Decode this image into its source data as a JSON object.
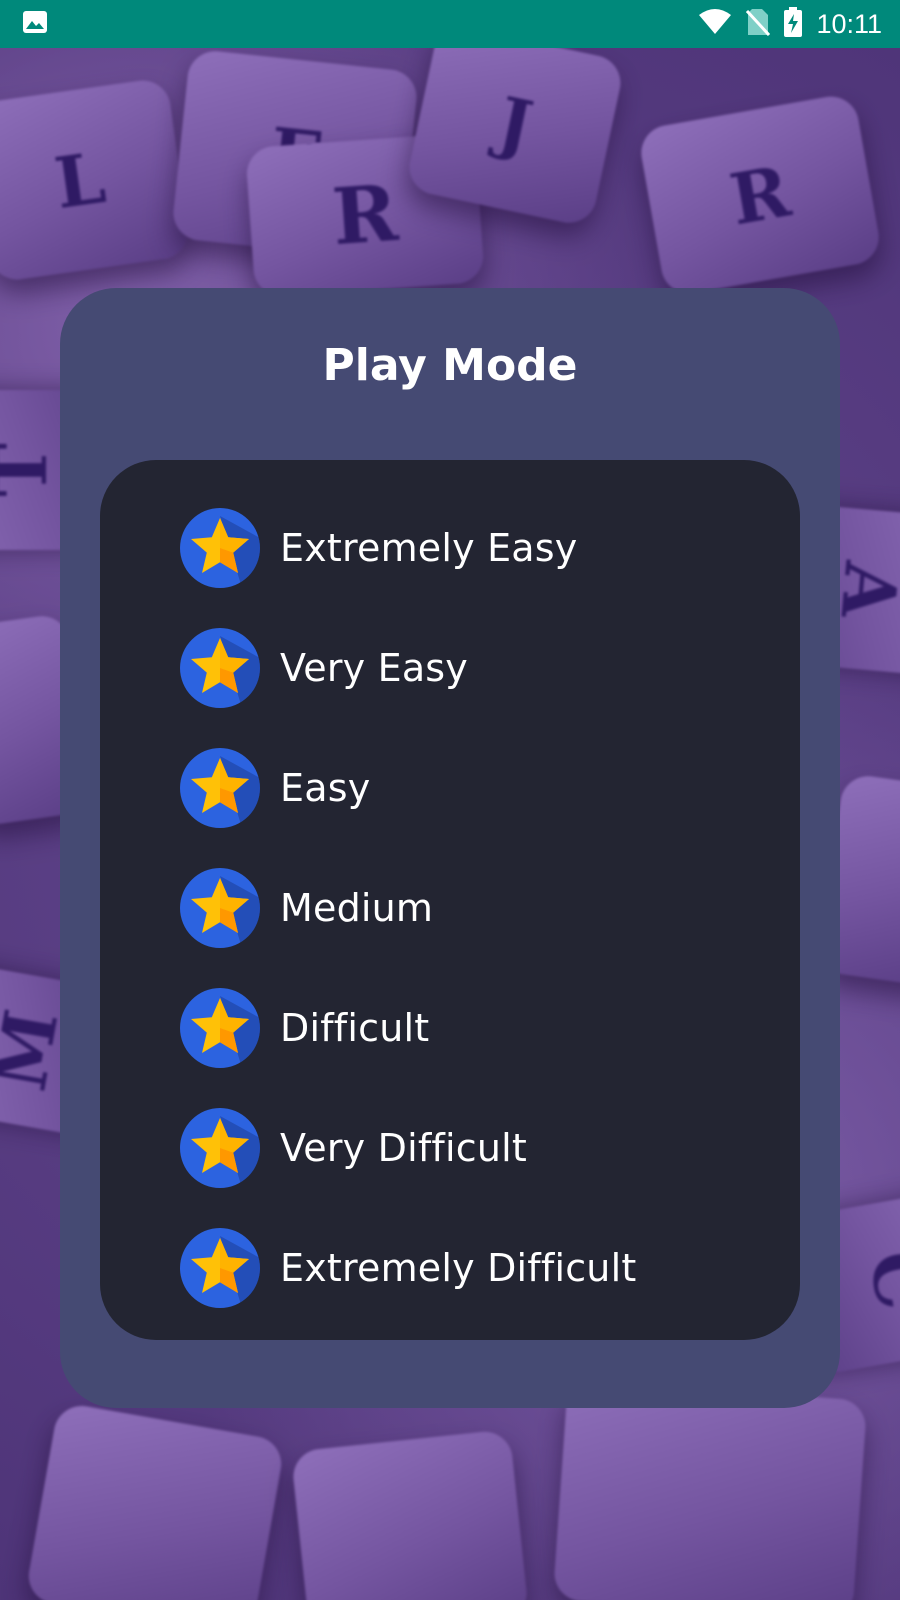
{
  "status_bar": {
    "time": "10:11",
    "left_icon": "image-icon",
    "icons": [
      "wifi-icon",
      "no-sim-icon",
      "battery-charging-icon"
    ],
    "color": "#00897b"
  },
  "background": {
    "tiles": [
      "L",
      "F",
      "R",
      "J",
      "R",
      "T",
      "A",
      "M",
      "C"
    ]
  },
  "dialog": {
    "title": "Play Mode",
    "modes": [
      {
        "label": "Extremely Easy",
        "icon": "star-icon"
      },
      {
        "label": "Very Easy",
        "icon": "star-icon"
      },
      {
        "label": "Easy",
        "icon": "star-icon"
      },
      {
        "label": "Medium",
        "icon": "star-icon"
      },
      {
        "label": "Difficult",
        "icon": "star-icon"
      },
      {
        "label": "Very Difficult",
        "icon": "star-icon"
      },
      {
        "label": "Extremely Difficult",
        "icon": "star-icon"
      }
    ],
    "colors": {
      "card": "#454a73",
      "list": "#232532",
      "badge": "#2c63e0",
      "star": "#ffc107"
    }
  }
}
